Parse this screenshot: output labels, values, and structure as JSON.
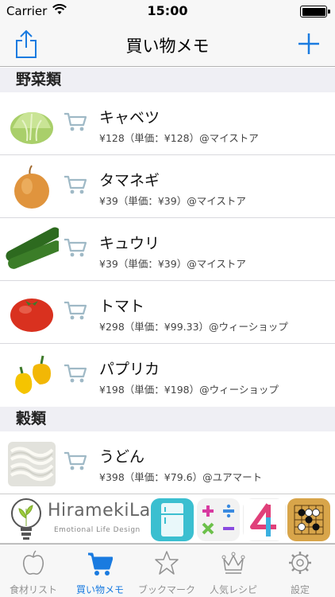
{
  "status_bar": {
    "carrier": "Carrier",
    "time": "15:00"
  },
  "nav": {
    "title": "買い物メモ",
    "share_icon": "share-icon",
    "add_icon": "plus-icon"
  },
  "colors": {
    "accent": "#1a7be0",
    "tab_inactive": "#929292",
    "section_bg": "#efeff4"
  },
  "sections": [
    {
      "title": "野菜類",
      "items": [
        {
          "name": "キャベツ",
          "detail": "¥128（単価：¥128）@マイストア",
          "image": "cabbage"
        },
        {
          "name": "タマネギ",
          "detail": "¥39（単価：¥39）@マイストア",
          "image": "onion"
        },
        {
          "name": "キュウリ",
          "detail": "¥39（単価：¥39）@マイストア",
          "image": "cucumber"
        },
        {
          "name": "トマト",
          "detail": "¥298（単価：¥99.33）@ウィーショップ",
          "image": "tomato"
        },
        {
          "name": "パプリカ",
          "detail": "¥198（単価：¥198）@ウィーショップ",
          "image": "paprika"
        }
      ]
    },
    {
      "title": "穀類",
      "items": [
        {
          "name": "うどん",
          "detail": "¥398（単価：¥79.6）@ユアマート",
          "image": "udon"
        }
      ]
    }
  ],
  "ad": {
    "brand": "HiramekiLab",
    "tagline": "Emotional Life Design"
  },
  "tabs": [
    {
      "label": "食材リスト",
      "icon": "apple-icon",
      "active": false
    },
    {
      "label": "買い物メモ",
      "icon": "cart-icon",
      "active": true
    },
    {
      "label": "ブックマーク",
      "icon": "star-icon",
      "active": false
    },
    {
      "label": "人気レシピ",
      "icon": "crown-icon",
      "active": false
    },
    {
      "label": "設定",
      "icon": "gear-icon",
      "active": false
    }
  ]
}
